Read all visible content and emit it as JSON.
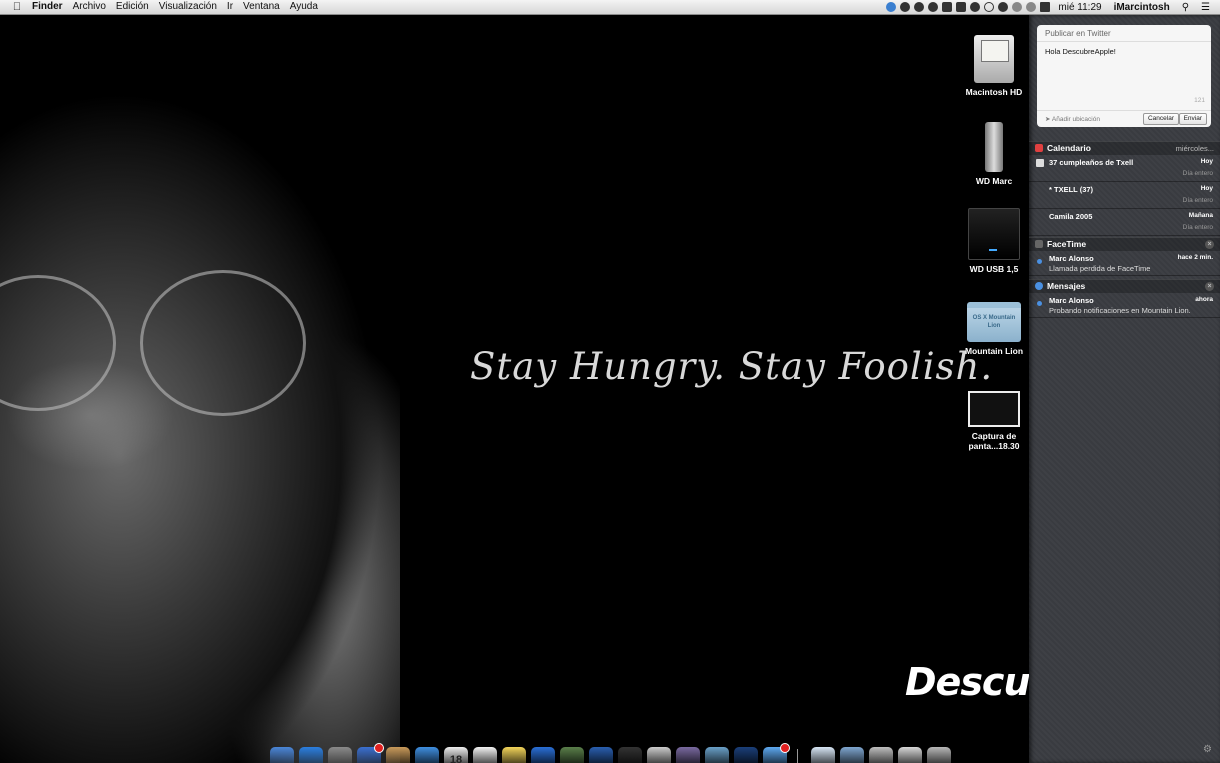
{
  "menubar": {
    "app": "Finder",
    "items": [
      "Archivo",
      "Edición",
      "Visualización",
      "Ir",
      "Ventana",
      "Ayuda"
    ],
    "clock": "mié 11:29",
    "user": "iMarcintosh"
  },
  "desktop": {
    "quote": "Stay Hungry. Stay Foolish.",
    "watermark": "DescubreApple",
    "icons": [
      {
        "label": "Macintosh HD",
        "icon": "hard-drive-icon"
      },
      {
        "label": "WD Marc",
        "icon": "external-drive-icon"
      },
      {
        "label": "WD USB 1,5",
        "icon": "usb-drive-icon"
      },
      {
        "label": "Mountain Lion",
        "icon": "folder-icon",
        "art_text": "OS X Mountain Lion"
      },
      {
        "label": "Captura de panta...18.30",
        "icon": "screenshot-icon"
      }
    ]
  },
  "notification_center": {
    "twitter": {
      "title": "Publicar en Twitter",
      "text": "Hola DescubreApple!",
      "count": "121",
      "location": "Añadir ubicación",
      "cancel": "Cancelar",
      "send": "Enviar"
    },
    "calendar": {
      "title": "Calendario",
      "date": "miércoles...",
      "events": [
        {
          "title": "37 cumpleaños de Txell",
          "when": "Hoy",
          "duration": "Día entero"
        },
        {
          "title": "* TXELL  (37)",
          "when": "Hoy",
          "duration": "Día entero"
        },
        {
          "title": "Camila 2005",
          "when": "Mañana",
          "duration": "Día entero"
        }
      ]
    },
    "facetime": {
      "title": "FaceTime",
      "items": [
        {
          "name": "Marc Alonso",
          "time": "hace 2 min.",
          "message": "Llamada perdida de FaceTime"
        }
      ]
    },
    "messages": {
      "title": "Mensajes",
      "items": [
        {
          "name": "Marc Alonso",
          "time": "ahora",
          "message": "Probando notificaciones en Mountain Lion."
        }
      ]
    }
  },
  "dock": {
    "apps": [
      {
        "name": "finder-icon",
        "color": "#4a86d8"
      },
      {
        "name": "app-store-icon",
        "color": "#2a7ee0"
      },
      {
        "name": "launchpad-icon",
        "color": "#8a8a8a"
      },
      {
        "name": "pixelmator-icon",
        "color": "#3a6fd0",
        "badge": true
      },
      {
        "name": "contacts-icon",
        "color": "#c99a5a"
      },
      {
        "name": "safari-icon",
        "color": "#3f8fe0"
      },
      {
        "name": "calendar-icon",
        "color": "#eeeeee",
        "label": "18"
      },
      {
        "name": "reminders-icon",
        "color": "#f2f2f2"
      },
      {
        "name": "notes-icon",
        "color": "#f2d45a"
      },
      {
        "name": "itunes-icon",
        "color": "#2a6fd6"
      },
      {
        "name": "iphoto-icon",
        "color": "#5a7f4a"
      },
      {
        "name": "word-icon",
        "color": "#2a5fb0"
      },
      {
        "name": "kindle-icon",
        "color": "#333333"
      },
      {
        "name": "mouse-icon",
        "color": "#cccccc"
      },
      {
        "name": "quill-icon",
        "color": "#7a6aa0"
      },
      {
        "name": "preview-icon",
        "color": "#6aa0c8"
      },
      {
        "name": "photoshop-icon",
        "color": "#1b3f7a"
      },
      {
        "name": "messages-icon",
        "color": "#5ea8f0",
        "badge": true
      },
      {
        "name": "keyboard-viewer-icon",
        "color": "#d8e6f5"
      },
      {
        "name": "applications-folder-icon",
        "color": "#7fa6d0"
      },
      {
        "name": "photos-folder-icon",
        "color": "#bfbfbf"
      },
      {
        "name": "downloads-folder-icon",
        "color": "#d8d8d8"
      },
      {
        "name": "trash-icon",
        "color": "#b8b8b8"
      }
    ]
  }
}
